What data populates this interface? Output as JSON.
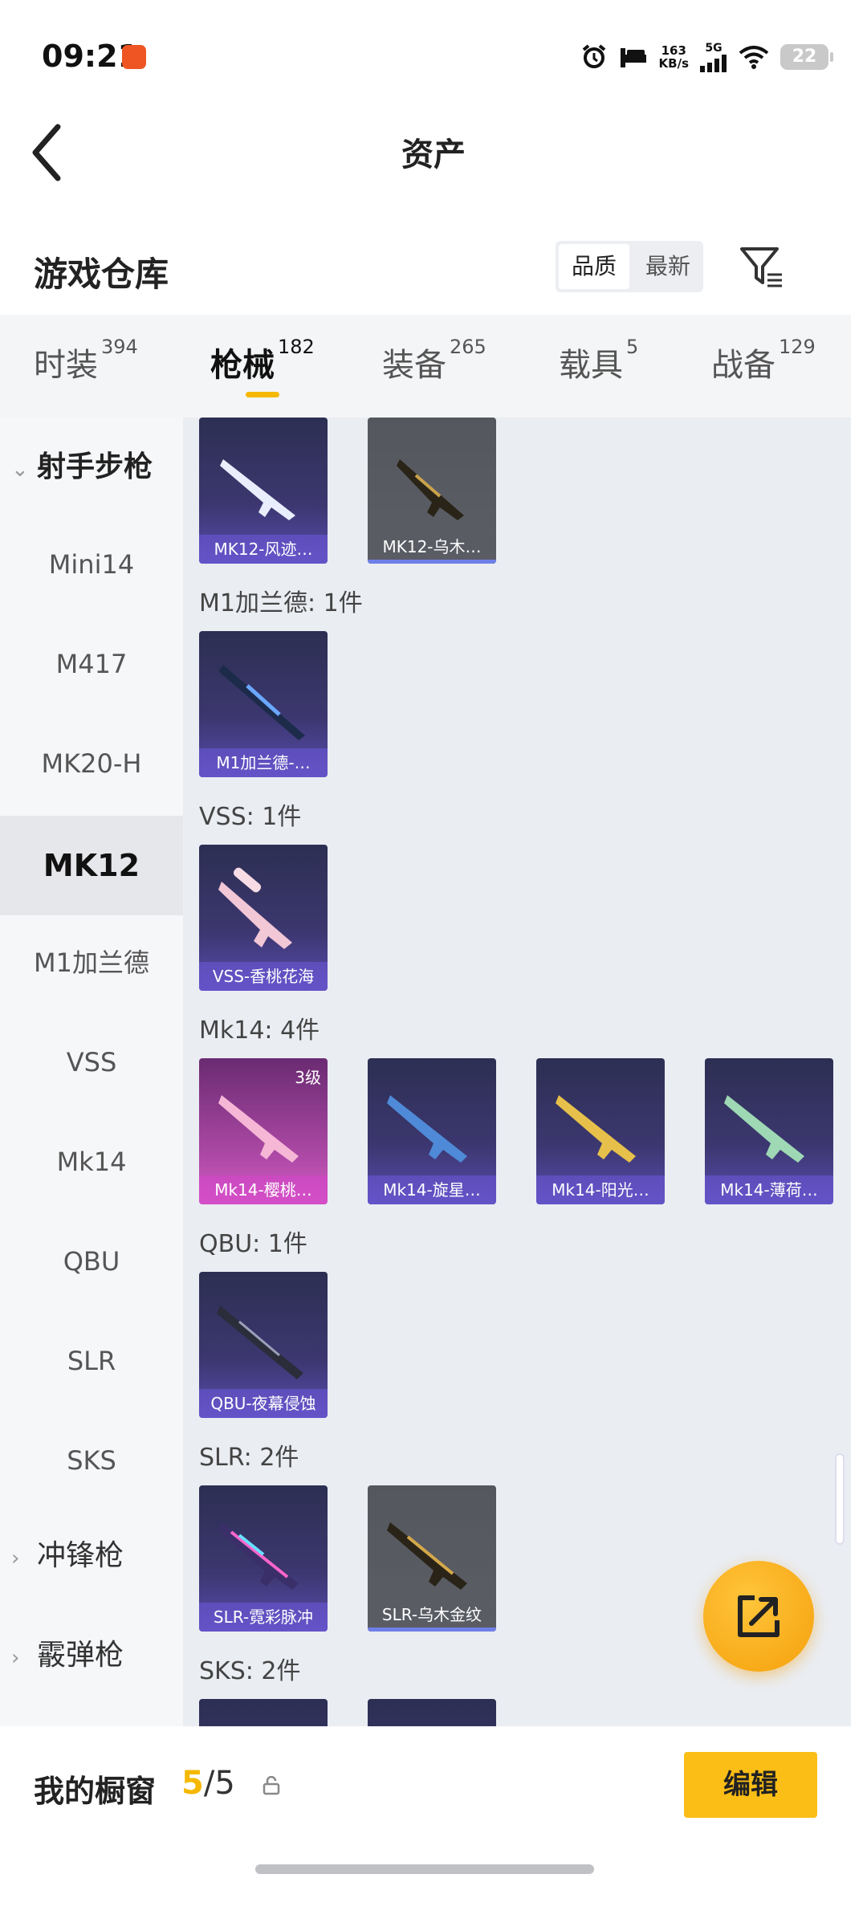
{
  "status_bar": {
    "time": "09:21",
    "net_speed": "163",
    "net_unit": "KB/s",
    "network": "5G",
    "battery": "22"
  },
  "nav": {
    "title": "资产"
  },
  "warehouse": {
    "title": "游戏仓库",
    "sort_options": [
      "品质",
      "最新"
    ],
    "sort_active": "品质"
  },
  "tabs": [
    {
      "label": "时装",
      "count": "394"
    },
    {
      "label": "枪械",
      "count": "182"
    },
    {
      "label": "装备",
      "count": "265"
    },
    {
      "label": "载具",
      "count": "5"
    },
    {
      "label": "战备",
      "count": "129"
    }
  ],
  "sidebar": {
    "category_open": "射手步枪",
    "items": [
      "Mini14",
      "M417",
      "MK20-H",
      "MK12",
      "M1加兰德",
      "VSS",
      "Mk14",
      "QBU",
      "SLR",
      "SKS"
    ],
    "active_item": "MK12",
    "categories_collapsed": [
      "冲锋枪",
      "霰弹枪"
    ]
  },
  "content": {
    "top_cards": [
      {
        "name": "MK12-风迹…",
        "style": "purple"
      },
      {
        "name": "MK12-乌木…",
        "style": "grey"
      }
    ],
    "groups": [
      {
        "label": "M1加兰德: 1件",
        "cards": [
          {
            "name": "M1加兰德-…",
            "style": "purple"
          }
        ]
      },
      {
        "label": "VSS: 1件",
        "cards": [
          {
            "name": "VSS-香桃花海",
            "style": "purple"
          }
        ]
      },
      {
        "label": "Mk14: 4件",
        "cards": [
          {
            "name": "Mk14-樱桃…",
            "style": "pink",
            "level": "3级"
          },
          {
            "name": "Mk14-旋星…",
            "style": "purple"
          },
          {
            "name": "Mk14-阳光…",
            "style": "purple"
          },
          {
            "name": "Mk14-薄荷…",
            "style": "purple"
          }
        ]
      },
      {
        "label": "QBU: 1件",
        "cards": [
          {
            "name": "QBU-夜幕侵蚀",
            "style": "purple"
          }
        ]
      },
      {
        "label": "SLR: 2件",
        "cards": [
          {
            "name": "SLR-霓彩脉冲",
            "style": "purple"
          },
          {
            "name": "SLR-乌木金纹",
            "style": "grey"
          }
        ]
      },
      {
        "label": "SKS: 2件",
        "cards": []
      }
    ]
  },
  "bottom_bar": {
    "showcase_label": "我的橱窗",
    "showcase_current": "5",
    "showcase_sep": "/",
    "showcase_total": "5",
    "edit_label": "编辑"
  },
  "colors": {
    "accent": "#f5b800",
    "card_purple": "#3c3770",
    "card_grey": "#5c5e66",
    "card_pink": "#d85fc6"
  }
}
